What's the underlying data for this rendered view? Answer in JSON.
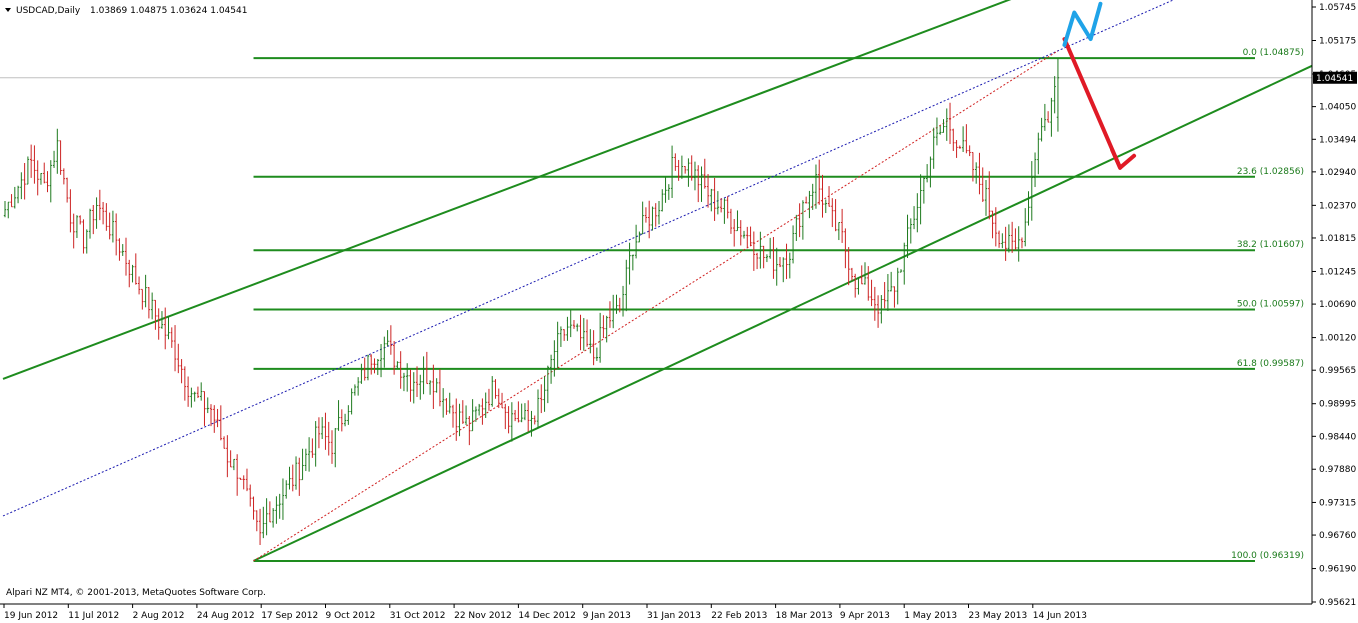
{
  "header": {
    "symbol": "USDCAD,Daily",
    "ohlc": "1.03869 1.04875 1.03624 1.04541",
    "dropdown_icon": "triangle-down-icon"
  },
  "footer": {
    "copyright": "Alpari NZ MT4, © 2001-2013, MetaQuotes Software Corp."
  },
  "current_price": "1.04541",
  "colors": {
    "background": "#ffffff",
    "bull": "#1e7a1e",
    "bear": "#cc2222",
    "channel": "#1e8c1e",
    "fib": "#1e8c1e",
    "fib_trend": "#d02020",
    "regression": "#1a1ab0",
    "arrow_red": "#e01a26",
    "arrow_blue": "#1fa3e8",
    "price_line": "#c0c0c0",
    "price_label_bg": "#000000",
    "price_label_fg": "#ffffff"
  },
  "chart_data": {
    "type": "candlestick",
    "instrument": "USDCAD",
    "timeframe": "Daily",
    "ylim": [
      0.95621,
      1.05745
    ],
    "y_ticks": [
      "1.05745",
      "1.05175",
      "1.04605",
      "1.04050",
      "1.03494",
      "1.02940",
      "1.02370",
      "1.01815",
      "1.01245",
      "1.00690",
      "1.00120",
      "0.99565",
      "0.98995",
      "0.98440",
      "0.97880",
      "0.97315",
      "0.96760",
      "0.96190",
      "0.95621"
    ],
    "x_labels": [
      "19 Jun 2012",
      "11 Jul 2012",
      "2 Aug 2012",
      "24 Aug 2012",
      "17 Sep 2012",
      "9 Oct 2012",
      "31 Oct 2012",
      "22 Nov 2012",
      "14 Dec 2012",
      "9 Jan 2013",
      "31 Jan 2013",
      "22 Feb 2013",
      "18 Mar 2013",
      "9 Apr 2013",
      "1 May 2013",
      "23 May 2013",
      "14 Jun 2013"
    ],
    "price_path": [
      [
        0,
        1.023
      ],
      [
        8,
        1.031
      ],
      [
        12,
        1.027
      ],
      [
        16,
        1.034
      ],
      [
        20,
        1.022
      ],
      [
        24,
        1.018
      ],
      [
        28,
        1.024
      ],
      [
        34,
        1.018
      ],
      [
        40,
        1.011
      ],
      [
        46,
        1.005
      ],
      [
        52,
        0.999
      ],
      [
        56,
        0.993
      ],
      [
        58,
        0.991
      ],
      [
        63,
        0.989
      ],
      [
        68,
        0.981
      ],
      [
        72,
        0.978
      ],
      [
        76,
        0.97
      ],
      [
        78,
        0.967
      ],
      [
        80,
        0.971
      ],
      [
        84,
        0.974
      ],
      [
        88,
        0.977
      ],
      [
        92,
        0.981
      ],
      [
        96,
        0.985
      ],
      [
        100,
        0.983
      ],
      [
        104,
        0.989
      ],
      [
        108,
        0.993
      ],
      [
        112,
        0.998
      ],
      [
        116,
        1.0
      ],
      [
        120,
        0.997
      ],
      [
        124,
        0.994
      ],
      [
        130,
        0.995
      ],
      [
        134,
        0.991
      ],
      [
        138,
        0.988
      ],
      [
        142,
        0.986
      ],
      [
        146,
        0.99
      ],
      [
        150,
        0.993
      ],
      [
        154,
        0.988
      ],
      [
        160,
        0.987
      ],
      [
        164,
        0.99
      ],
      [
        168,
        0.999
      ],
      [
        172,
        1.003
      ],
      [
        176,
        1.001
      ],
      [
        180,
        0.998
      ],
      [
        184,
        1.004
      ],
      [
        188,
        1.006
      ],
      [
        192,
        1.017
      ],
      [
        196,
        1.021
      ],
      [
        200,
        1.024
      ],
      [
        204,
        1.03
      ],
      [
        208,
        1.031
      ],
      [
        212,
        1.028
      ],
      [
        216,
        1.025
      ],
      [
        220,
        1.023
      ],
      [
        224,
        1.02
      ],
      [
        228,
        1.018
      ],
      [
        232,
        1.015
      ],
      [
        236,
        1.014
      ],
      [
        240,
        1.016
      ],
      [
        244,
        1.024
      ],
      [
        248,
        1.028
      ],
      [
        252,
        1.022
      ],
      [
        256,
        1.018
      ],
      [
        260,
        1.011
      ],
      [
        264,
        1.009
      ],
      [
        268,
        1.006
      ],
      [
        272,
        1.01
      ],
      [
        276,
        1.018
      ],
      [
        280,
        1.026
      ],
      [
        284,
        1.034
      ],
      [
        288,
        1.038
      ],
      [
        292,
        1.034
      ],
      [
        296,
        1.03
      ],
      [
        300,
        1.025
      ],
      [
        303,
        1.02
      ],
      [
        306,
        1.017
      ],
      [
        309,
        1.016
      ],
      [
        312,
        1.021
      ],
      [
        316,
        1.036
      ],
      [
        319,
        1.039
      ],
      [
        322,
        1.0454
      ]
    ],
    "fibonacci": [
      {
        "level": "0.0",
        "price": 1.04875,
        "label": "0.0 (1.04875)"
      },
      {
        "level": "23.6",
        "price": 1.02856,
        "label": "23.6 (1.02856)"
      },
      {
        "level": "38.2",
        "price": 1.01607,
        "label": "38.2 (1.01607)"
      },
      {
        "level": "50.0",
        "price": 1.00597,
        "label": "50.0 (1.00597)"
      },
      {
        "level": "61.8",
        "price": 0.99587,
        "label": "61.8 (0.99587)"
      },
      {
        "level": "100.0",
        "price": 0.96319,
        "label": "100.0 (0.96319)"
      }
    ],
    "channel_upper": [
      [
        0,
        0.9943
      ],
      [
        300,
        1.0572
      ]
    ],
    "channel_lower": [
      [
        76,
        0.9632
      ],
      [
        300,
        1.0215
      ]
    ],
    "regression_line": [
      [
        0,
        0.971
      ],
      [
        300,
        1.0446
      ]
    ],
    "fib_trend_line": [
      [
        76,
        0.9632
      ],
      [
        322,
        1.05
      ]
    ],
    "annotations": [
      {
        "type": "arrow",
        "color": "red",
        "from": [
          324,
          1.052
        ],
        "to": [
          341,
          1.0301
        ]
      },
      {
        "type": "zigzag",
        "color": "blue",
        "points": [
          [
            324,
            1.051
          ],
          [
            327,
            1.0565
          ],
          [
            332,
            1.052
          ],
          [
            335,
            1.058
          ]
        ]
      }
    ]
  }
}
